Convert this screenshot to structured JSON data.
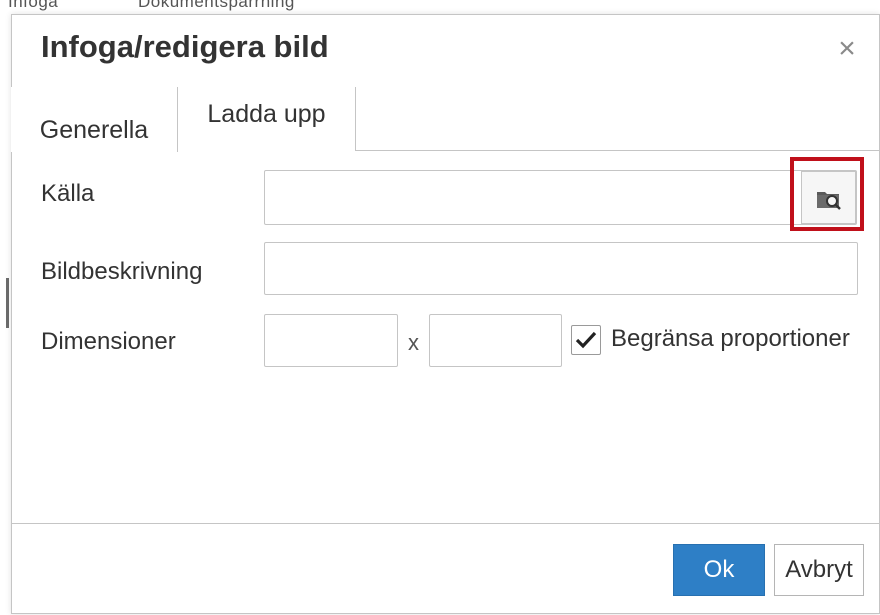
{
  "background": {
    "text_left": "Infoga",
    "text_right": "Dokumentspärrning"
  },
  "dialog": {
    "title": "Infoga/redigera bild",
    "close_glyph": "×",
    "tabs": [
      {
        "label": "Generella",
        "active": true
      },
      {
        "label": "Ladda upp",
        "active": false
      }
    ],
    "fields": {
      "source": {
        "label": "Källa",
        "value": "",
        "browse_icon": "folder-search-icon"
      },
      "description": {
        "label": "Bildbeskrivning",
        "value": ""
      },
      "dimensions": {
        "label": "Dimensioner",
        "width_value": "",
        "separator": "x",
        "height_value": "",
        "constrain_label": "Begränsa proportioner",
        "constrain_checked": true
      }
    },
    "buttons": {
      "ok_label": "Ok",
      "cancel_label": "Avbryt"
    }
  },
  "colors": {
    "primary": "#2e7fc6",
    "highlight": "#c0101a"
  }
}
